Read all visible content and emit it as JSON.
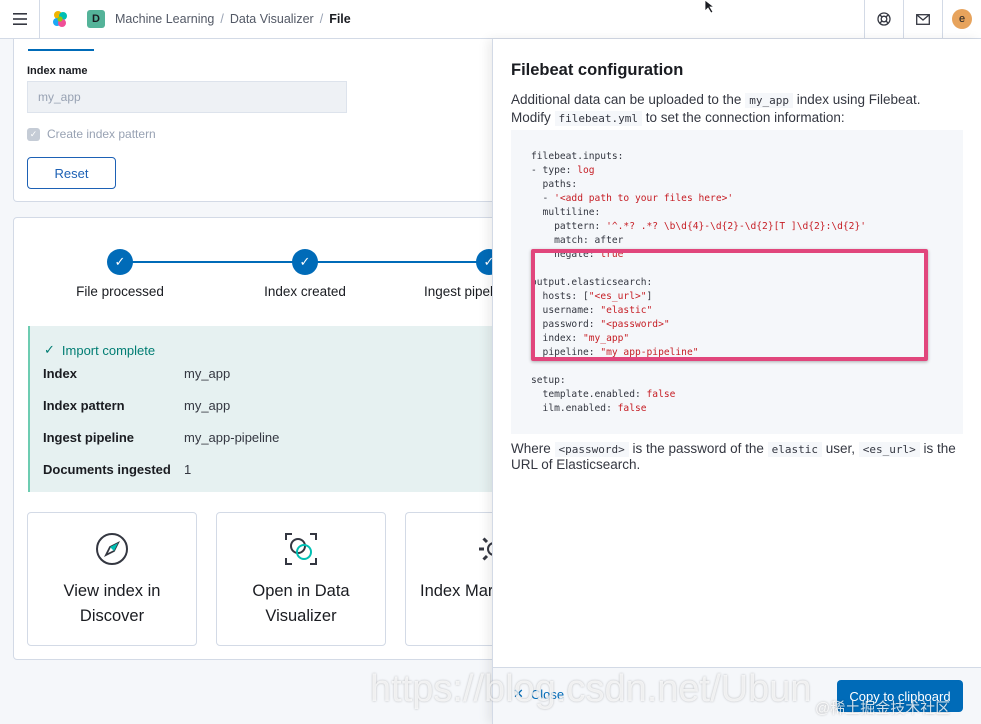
{
  "header": {
    "space_initial": "D",
    "breadcrumbs": [
      "Machine Learning",
      "Data Visualizer",
      "File"
    ],
    "breadcrumb_separator": "/",
    "user_initial": "e"
  },
  "import_form": {
    "index_name_label": "Index name",
    "index_name_value": "my_app",
    "create_index_pattern_label": "Create index pattern",
    "reset_label": "Reset"
  },
  "steps": [
    {
      "title": "File processed"
    },
    {
      "title": "Index created"
    },
    {
      "title": "Ingest pipel"
    }
  ],
  "import_result": {
    "title": "Import complete",
    "rows": [
      {
        "key": "Index",
        "value": "my_app"
      },
      {
        "key": "Index pattern",
        "value": "my_app"
      },
      {
        "key": "Ingest pipeline",
        "value": "my_app-pipeline"
      },
      {
        "key": "Documents ingested",
        "value": "1"
      }
    ]
  },
  "cards": [
    {
      "line1": "View index in",
      "line2": "Discover",
      "icon": "compass-icon"
    },
    {
      "line1": "Open in Data",
      "line2": "Visualizer",
      "icon": "data-visualizer-icon"
    },
    {
      "line1": "Index Mar",
      "line2": "",
      "icon": "gear-icon"
    }
  ],
  "flyout": {
    "title": "Filebeat configuration",
    "desc_1": "Additional data can be uploaded to the",
    "desc_index": "my_app",
    "desc_2": "index using Filebeat.",
    "desc_3": "Modify",
    "desc_file": "filebeat.yml",
    "desc_4": "to set the connection information:",
    "code_lines": [
      "filebeat.inputs:",
      "- type: log",
      "  paths:",
      "  - '<add path to your files here>'",
      "  multiline:",
      "    pattern: '^.*? .*? \\b\\d{4}-\\d{2}-\\d{2}[T ]\\d{2}:\\d{2}'",
      "    match: after",
      "    negate: true",
      "",
      "output.elasticsearch:",
      "  hosts: [\"<es_url>\"]",
      "  username: \"elastic\"",
      "  password: \"<password>\"",
      "  index: \"my_app\"",
      "  pipeline: \"my_app-pipeline\"",
      "",
      "setup:",
      "  template.enabled: false",
      "  ilm.enabled: false"
    ],
    "note_1": "Where",
    "note_password": "<password>",
    "note_2": "is the password of the",
    "note_elastic": "elastic",
    "note_3": "user,",
    "note_esurl": "<es_url>",
    "note_4": "is the URL of Elasticsearch.",
    "close_label": "Close",
    "copy_label": "Copy to clipboard"
  },
  "watermark": {
    "text": "https://blog.csdn.net/Ubun",
    "text2": "@稀土掘金技术社区"
  },
  "colors": {
    "primary": "#006bb8",
    "success_bg": "#e6f1f1",
    "success_text": "#017d73",
    "highlight": "#e1467c",
    "code_string": "#c61e25"
  }
}
